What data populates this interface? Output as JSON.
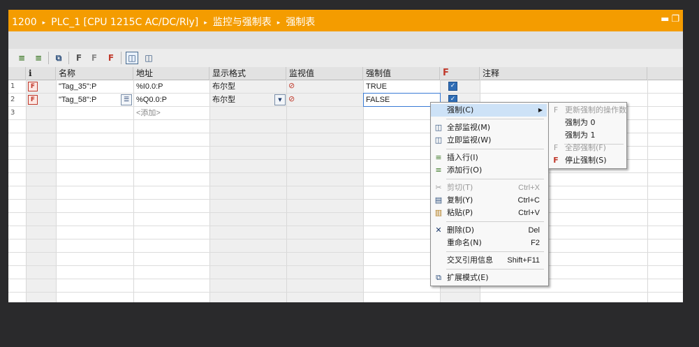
{
  "titlebar": {
    "crumbs": [
      "1200",
      "PLC_1 [CPU 1215C AC/DC/Rly]",
      "监控与强制表",
      "强制表"
    ],
    "separator": "▸",
    "window_buttons": "▬❐"
  },
  "toolbar": {
    "buttons": [
      "insert-row-icon",
      "add-row-icon",
      "expanded-mode-icon",
      "update-force-icon",
      "force-all-icon",
      "stop-force-icon",
      "monitor-all-icon",
      "monitor-now-icon"
    ]
  },
  "table": {
    "headers": [
      "i",
      "名称",
      "地址",
      "显示格式",
      "监视值",
      "强制值",
      "F",
      "注释"
    ],
    "rows": [
      {
        "num": "1",
        "name": "\"Tag_35\":P",
        "address": "%I0.0:P",
        "format": "布尔型",
        "force_value": "TRUE",
        "force_checked": true
      },
      {
        "num": "2",
        "name": "\"Tag_58\":P",
        "address": "%Q0.0:P",
        "format": "布尔型",
        "force_value": "FALSE",
        "force_checked": true
      },
      {
        "num": "3",
        "name": "",
        "address": "<添加>",
        "format": "",
        "force_value": "",
        "force_checked": false
      }
    ]
  },
  "context_menu": {
    "items": [
      {
        "label": "强制(C)",
        "shortcut": "",
        "disabled": false,
        "icon": "",
        "submenu": true
      },
      {
        "label": "全部监视(M)",
        "shortcut": "",
        "disabled": false,
        "icon": "monitor-all-icon"
      },
      {
        "label": "立即监视(W)",
        "shortcut": "",
        "disabled": false,
        "icon": "monitor-now-icon"
      },
      {
        "label": "插入行(I)",
        "shortcut": "",
        "disabled": false,
        "icon": "insert-row-icon"
      },
      {
        "label": "添加行(O)",
        "shortcut": "",
        "disabled": false,
        "icon": "add-row-icon"
      },
      {
        "label": "剪切(T)",
        "shortcut": "Ctrl+X",
        "disabled": true,
        "icon": "cut-icon"
      },
      {
        "label": "复制(Y)",
        "shortcut": "Ctrl+C",
        "disabled": false,
        "icon": "copy-icon"
      },
      {
        "label": "粘贴(P)",
        "shortcut": "Ctrl+V",
        "disabled": false,
        "icon": "paste-icon"
      },
      {
        "label": "删除(D)",
        "shortcut": "Del",
        "disabled": false,
        "icon": "delete-icon"
      },
      {
        "label": "重命名(N)",
        "shortcut": "F2",
        "disabled": false,
        "icon": ""
      },
      {
        "label": "交叉引用信息",
        "shortcut": "Shift+F11",
        "disabled": false,
        "icon": ""
      },
      {
        "label": "扩展模式(E)",
        "shortcut": "",
        "disabled": false,
        "icon": "expanded-mode-icon"
      }
    ]
  },
  "submenu": {
    "items": [
      {
        "label": "更新强制的操作数",
        "disabled": true,
        "icon": "update-force-icon"
      },
      {
        "label": "强制为 0",
        "disabled": false,
        "icon": ""
      },
      {
        "label": "强制为 1",
        "disabled": false,
        "icon": ""
      },
      {
        "label": "全部强制(F)",
        "disabled": true,
        "icon": "force-all-icon"
      },
      {
        "label": "停止强制(S)",
        "disabled": false,
        "icon": "stop-force-icon"
      }
    ]
  },
  "colors": {
    "titlebar": "#f49c00",
    "force_red": "#c0392b",
    "checkbox": "#2f6db5"
  }
}
